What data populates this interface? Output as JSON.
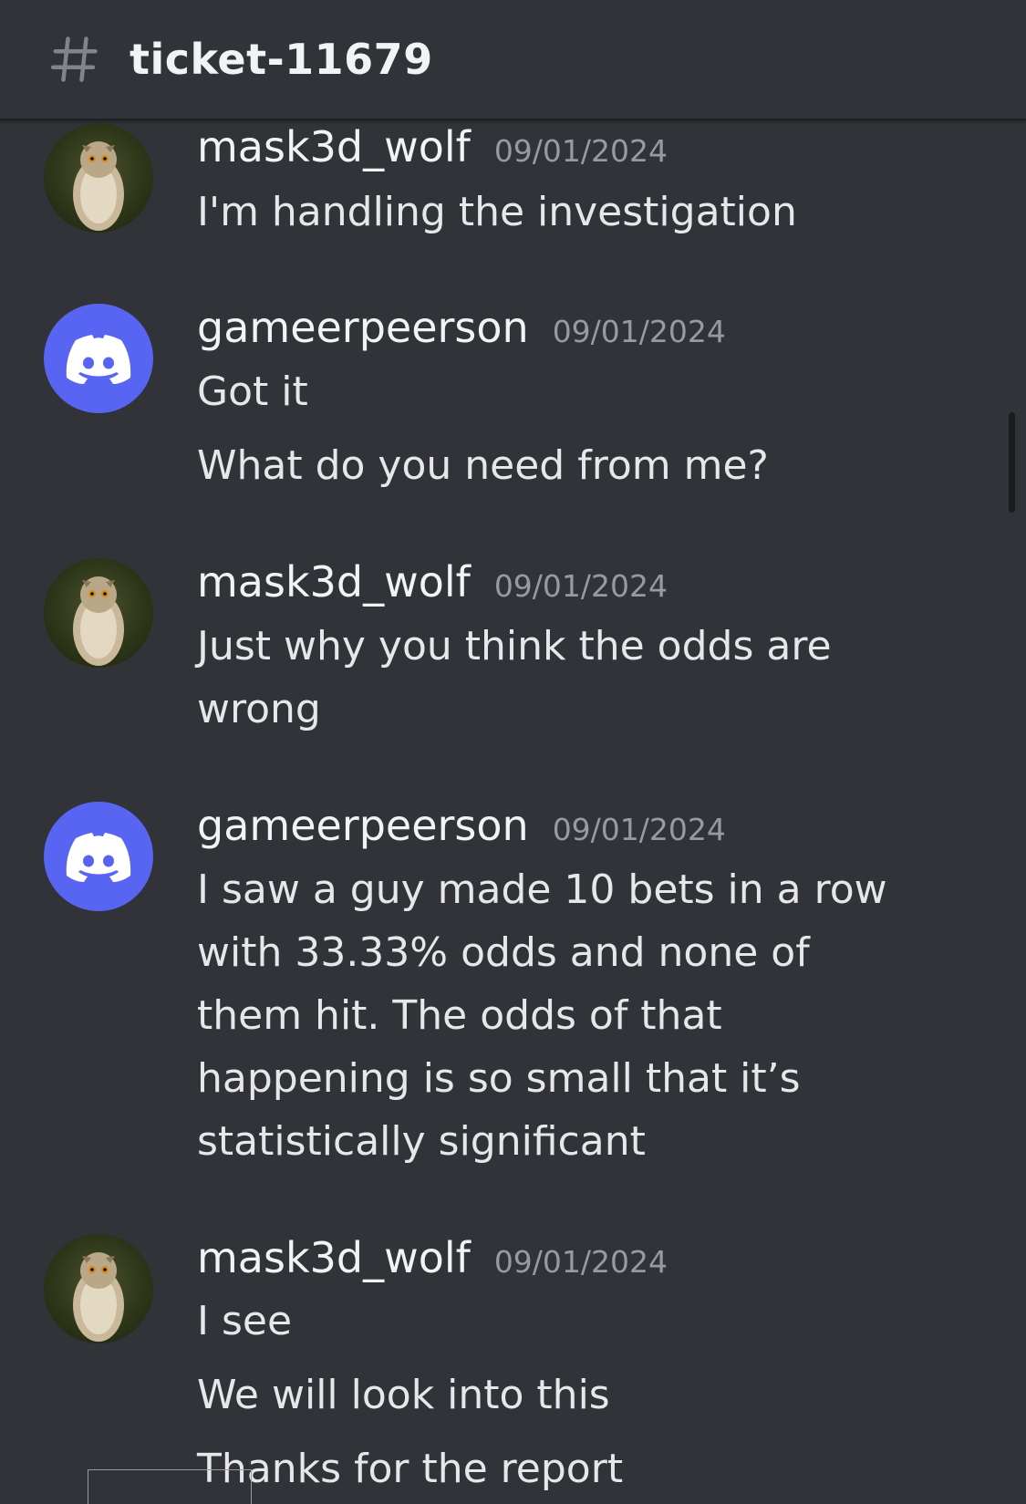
{
  "channel": {
    "icon": "hash-icon",
    "name": "ticket-11679"
  },
  "messages": [
    {
      "author": "mask3d_wolf",
      "avatar": "owl-avatar",
      "date": "09/01/2024",
      "lines": [
        "I'm handling the investigation"
      ]
    },
    {
      "author": "gameerpeerson",
      "avatar": "discord-logo-avatar",
      "date": "09/01/2024",
      "lines": [
        "Got it",
        "What do you need from me?"
      ]
    },
    {
      "author": "mask3d_wolf",
      "avatar": "owl-avatar",
      "date": "09/01/2024",
      "lines": [
        "Just why you think the odds are",
        "wrong"
      ]
    },
    {
      "author": "gameerpeerson",
      "avatar": "discord-logo-avatar",
      "date": "09/01/2024",
      "lines": [
        "I saw a guy made 10 bets in a row",
        "with 33.33% odds and none of",
        "them hit. The odds of that",
        "happening is so small that it’s",
        "statistically significant"
      ]
    },
    {
      "author": "mask3d_wolf",
      "avatar": "owl-avatar",
      "date": "09/01/2024",
      "lines": [
        "I see",
        "We will look into this",
        "Thanks for the report"
      ]
    }
  ],
  "colors": {
    "background": "#313338",
    "blurple": "#5865f2",
    "timestamp": "#949ba4"
  }
}
